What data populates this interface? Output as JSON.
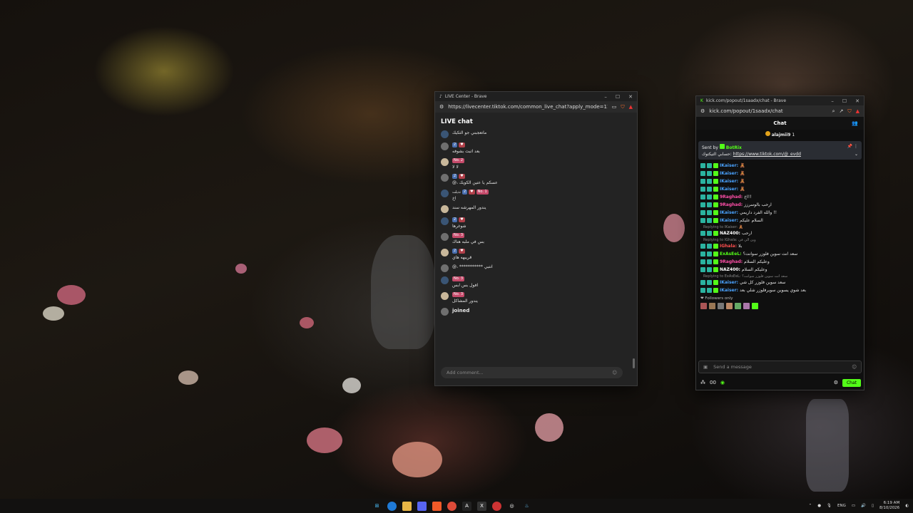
{
  "tiktok": {
    "title": "LIVE Center - Brave",
    "url": "https://livecenter.tiktok.com/common_live_chat?apply_mode=11",
    "heading": "LIVE chat",
    "messages": [
      {
        "name": "",
        "badges": [],
        "text": "ماتعجبني جو التكيك"
      },
      {
        "name": "",
        "badges": [
          "2",
          "♥"
        ],
        "text": "بعد اثبث بشوفه"
      },
      {
        "name": "",
        "badges": [
          "No. 2"
        ],
        "text": "لا لا"
      },
      {
        "name": "",
        "badges": [
          "2",
          "♥"
        ],
        "text": "@، عسكم يا عتين الكويك"
      },
      {
        "name": "تذيلت",
        "badges": [
          "2",
          "♥",
          "No. 1"
        ],
        "text": "اخ"
      },
      {
        "name": "",
        "badges": [],
        "text": "يندور المهرشه سند"
      },
      {
        "name": "",
        "badges": [
          "2",
          "♥"
        ],
        "text": "شوغرها"
      },
      {
        "name": "",
        "badges": [
          "No. 3"
        ],
        "text": "بس في ملبه هناك"
      },
      {
        "name": "",
        "badges": [
          "2",
          "♥"
        ],
        "text": "قريبهه هاي"
      },
      {
        "name": "",
        "badges": [],
        "text": "@، *********** انتبي"
      },
      {
        "name": "",
        "badges": [
          "No. 3"
        ],
        "text": "افول بس ابس"
      },
      {
        "name": "",
        "badges": [
          "No. 3"
        ],
        "text": "يندور المشاكل"
      }
    ],
    "joined": "joined",
    "comment_placeholder": "Add comment..."
  },
  "kick": {
    "title": "kick.com/popout/1saadx/chat - Brave",
    "url": "kick.com/popout/1saadx/chat",
    "chat_header": "Chat",
    "top_gifter": "alajmii9",
    "top_gifter_count": "1",
    "pinned_sender_label": "Sent by",
    "pinned_sender": "BotRix",
    "pinned_text": "حسابي التيكتوك:",
    "pinned_link": "https://www.tiktok.com/@_evdd",
    "rows": [
      {
        "reply": "",
        "name": "IKaiser:",
        "color": "#4aa3ff",
        "text": "🧸"
      },
      {
        "reply": "",
        "name": "IKaiser:",
        "color": "#4aa3ff",
        "text": "🧸"
      },
      {
        "reply": "",
        "name": "IKaiser:",
        "color": "#4aa3ff",
        "text": "🧸"
      },
      {
        "reply": "",
        "name": "IKaiser:",
        "color": "#4aa3ff",
        "text": "🧸"
      },
      {
        "reply": "",
        "name": "9Raghad:",
        "color": "#ff4fa8",
        "text": "اخ!!"
      },
      {
        "reply": "",
        "name": "9Raghad:",
        "color": "#ff4fa8",
        "text": "ارحب بالوسرزز"
      },
      {
        "reply": "",
        "name": "IKaiser:",
        "color": "#4aa3ff",
        "text": "والله الفرد داريمي !!"
      },
      {
        "reply": "",
        "name": "IKaiser:",
        "color": "#4aa3ff",
        "text": "السلام عليكم"
      },
      {
        "reply": "Replying to IKaiser: 🧸",
        "name": "NAZ400:",
        "color": "#ffffff",
        "text": "ارحب"
      },
      {
        "reply": "Replying to IGhala: وين الي في",
        "name": "IGhala:",
        "color": "#ff4f4f",
        "text": "بلا"
      },
      {
        "reply": "",
        "name": "ExAsEeL:",
        "color": "#53fc18",
        "text": "سعد انت سوين فلوزر سوانت؟"
      },
      {
        "reply": "",
        "name": "9Raghad:",
        "color": "#ff4fa8",
        "text": "وعليكم السلام"
      },
      {
        "reply": "",
        "name": "NAZ400:",
        "color": "#ffffff",
        "text": "وعليكم السلام"
      },
      {
        "reply": "Replying to ExAsEeL: سعد انت سوين فلوزر سوانت؟",
        "name": "IKaiser:",
        "color": "#4aa3ff",
        "text": "سعد سوين فلوزر كل شي"
      },
      {
        "reply": "",
        "name": "IKaiser:",
        "color": "#4aa3ff",
        "text": "بعد شوي يسوين سويرفلوزر شلي بعد"
      }
    ],
    "followers_only": "Followers only",
    "input_placeholder": "Send a message",
    "count": "00",
    "chat_button": "Chat"
  },
  "taskbar": {
    "lang": "ENG",
    "time": "6:19 AM",
    "date": "8/10/2026"
  }
}
